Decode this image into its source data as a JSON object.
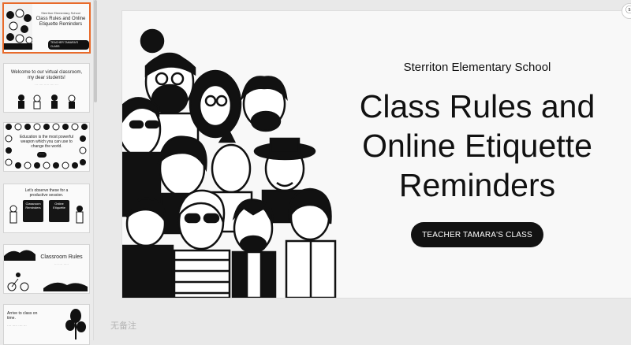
{
  "thumbnails": [
    {
      "small": "Sterriton Elementary School",
      "title": "Class Rules and Online Etiquette Reminders",
      "pill": "TEACHER TAMARA'S CLASS"
    },
    {
      "title": "Welcome to our virtual classroom, my dear students!"
    },
    {
      "title": "Education is the most powerful weapon which you can use to change the world."
    },
    {
      "title": "Let's observe these for a productive session.",
      "box1": "Classroom Reminders",
      "box2": "Online Etiquette"
    },
    {
      "title": "Classroom Rules"
    },
    {
      "title": "Arrive to class on time."
    }
  ],
  "slide": {
    "school": "Sterriton Elementary School",
    "title": "Class Rules and\nOnline Etiquette\nReminders",
    "button": "TEACHER TAMARA'S CLASS"
  },
  "notes_placeholder": "无备注",
  "corner_icon": "ⓢ"
}
